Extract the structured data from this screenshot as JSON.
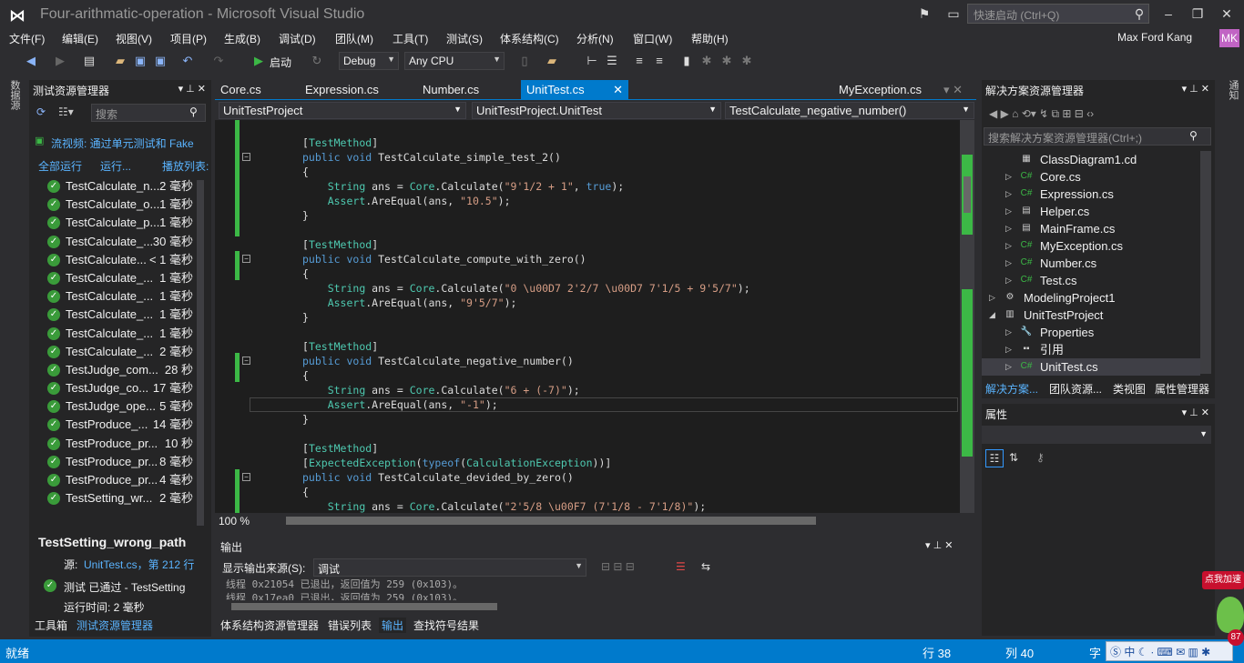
{
  "window": {
    "title": "Four-arithmatic-operation - Microsoft Visual Studio",
    "quick_launch": "快速启动 (Ctrl+Q)",
    "user": "Max Ford Kang",
    "avatar": "MK"
  },
  "menu": [
    "文件(F)",
    "编辑(E)",
    "视图(V)",
    "项目(P)",
    "生成(B)",
    "调试(D)",
    "团队(M)",
    "工具(T)",
    "测试(S)",
    "体系结构(C)",
    "分析(N)",
    "窗口(W)",
    "帮助(H)"
  ],
  "toolbar": {
    "start": "启动",
    "config": "Debug",
    "platform": "Any CPU"
  },
  "test_explorer": {
    "title": "测试资源管理器",
    "search_placeholder": "搜索",
    "playlist": "流视频: 通过单元测试和 Fake",
    "run_all": "全部运行",
    "run": "运行...",
    "playlist_link": "播放列表:",
    "tests": [
      {
        "name": "TestCalculate_n...",
        "time": "2 毫秒"
      },
      {
        "name": "TestCalculate_o...",
        "time": "1 毫秒"
      },
      {
        "name": "TestCalculate_p...",
        "time": "1 毫秒"
      },
      {
        "name": "TestCalculate_...",
        "time": "30 毫秒"
      },
      {
        "name": "TestCalculate...",
        "time": "< 1 毫秒"
      },
      {
        "name": "TestCalculate_...",
        "time": "1 毫秒"
      },
      {
        "name": "TestCalculate_...",
        "time": "1 毫秒"
      },
      {
        "name": "TestCalculate_...",
        "time": "1 毫秒"
      },
      {
        "name": "TestCalculate_...",
        "time": "1 毫秒"
      },
      {
        "name": "TestCalculate_...",
        "time": "2 毫秒"
      },
      {
        "name": "TestJudge_com...",
        "time": "28 秒"
      },
      {
        "name": "TestJudge_co...",
        "time": "17 毫秒"
      },
      {
        "name": "TestJudge_ope...",
        "time": "5 毫秒"
      },
      {
        "name": "TestProduce_...",
        "time": "14 毫秒"
      },
      {
        "name": "TestProduce_pr...",
        "time": "10 秒"
      },
      {
        "name": "TestProduce_pr...",
        "time": "8 毫秒"
      },
      {
        "name": "TestProduce_pr...",
        "time": "4 毫秒"
      },
      {
        "name": "TestSetting_wr...",
        "time": "2 毫秒"
      }
    ],
    "detail_title": "TestSetting_wrong_path",
    "source_label": "源:",
    "source_link": "UnitTest.cs，第 212 行",
    "result": "测试 已通过 - TestSetting",
    "runtime": "运行时间: 2 毫秒"
  },
  "left_bottom_tabs": [
    "工具箱",
    "测试资源管理器"
  ],
  "left_side_tab": "数据源",
  "editor": {
    "tabs": [
      "Core.cs",
      "Expression.cs",
      "Number.cs",
      "UnitTest.cs",
      "MyException.cs"
    ],
    "nav": [
      "UnitTestProject",
      "UnitTestProject.UnitTest",
      "TestCalculate_negative_number()"
    ],
    "zoom": "100 %"
  },
  "code": [
    "[TestMethod]",
    "public void TestCalculate_simple_test_2()",
    "{",
    "    String ans = Core.Calculate(\"9'1/2 + 1\", true);",
    "    Assert.AreEqual(ans, \"10.5\");",
    "}",
    "",
    "[TestMethod]",
    "public void TestCalculate_compute_with_zero()",
    "{",
    "    String ans = Core.Calculate(\"0 \\u00D7 2'2/7 \\u00D7 7'1/5 + 9'5/7\");",
    "    Assert.AreEqual(ans, \"9'5/7\");",
    "}",
    "",
    "[TestMethod]",
    "public void TestCalculate_negative_number()",
    "{",
    "    String ans = Core.Calculate(\"6 + (-7)\");",
    "    Assert.AreEqual(ans, \"-1\");",
    "}",
    "",
    "[TestMethod]",
    "[ExpectedException(typeof(CalculationException))]",
    "public void TestCalculate_devided_by_zero()",
    "{",
    "    String ans = Core.Calculate(\"2'5/8 \\u00F7 (7'1/8 - 7'1/8)\");"
  ],
  "output": {
    "title": "输出",
    "source_label": "显示输出来源(S):",
    "source": "调试",
    "lines": [
      "线程 0x21054 已退出，返回值为 259 (0x103)。",
      "线程 0x17ea0 已退出，返回值为 259 (0x103)。"
    ]
  },
  "bottom_tabs": [
    "体系结构资源管理器",
    "错误列表",
    "输出",
    "查找符号结果"
  ],
  "solution_explorer": {
    "title": "解决方案资源管理器",
    "search_placeholder": "搜索解决方案资源管理器(Ctrl+;)",
    "items": [
      "ClassDiagram1.cd",
      "Core.cs",
      "Expression.cs",
      "Helper.cs",
      "MainFrame.cs",
      "MyException.cs",
      "Number.cs",
      "Test.cs",
      "ModelingProject1",
      "UnitTestProject",
      "Properties",
      "引用",
      "UnitTest.cs"
    ],
    "tabs": [
      "解决方案...",
      "团队资源...",
      "类视图",
      "属性管理器"
    ]
  },
  "properties": {
    "title": "属性"
  },
  "right_side_tab": "通知",
  "status": {
    "ready": "就绪",
    "line": "行 38",
    "col": "列 40",
    "char": "字"
  },
  "ime": {
    "lang": "中",
    "badge": "87",
    "ad": "点我加速"
  }
}
